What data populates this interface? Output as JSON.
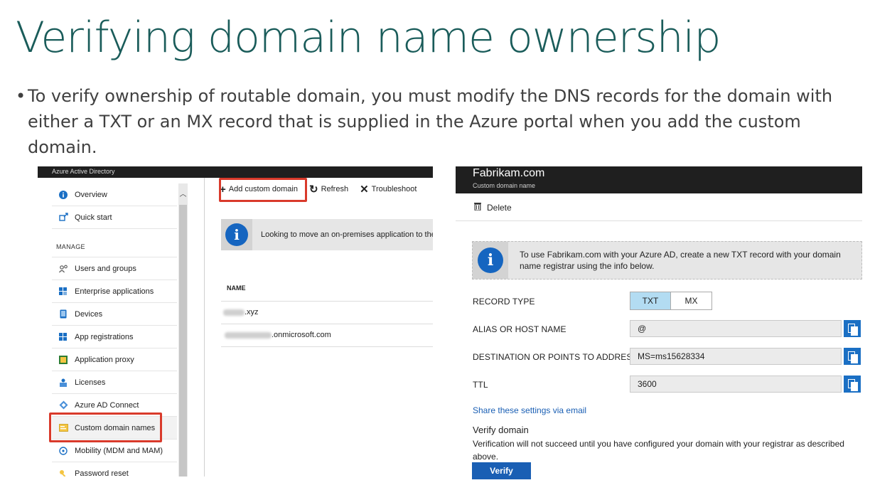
{
  "slide": {
    "title": "Verifying domain name ownership",
    "bullet": "To verify ownership of routable domain, you must modify the DNS records for the domain with either a TXT or an MX record that is supplied in the Azure portal when you add the custom domain."
  },
  "left_panel": {
    "app_title": "Azure Active Directory",
    "nav_top": [
      {
        "label": "Overview",
        "icon": "info-icon"
      },
      {
        "label": "Quick start",
        "icon": "rocket-icon"
      }
    ],
    "manage_heading": "MANAGE",
    "nav_manage": [
      {
        "label": "Users and groups",
        "icon": "users-icon"
      },
      {
        "label": "Enterprise applications",
        "icon": "grid-icon"
      },
      {
        "label": "Devices",
        "icon": "device-icon"
      },
      {
        "label": "App registrations",
        "icon": "grid-icon"
      },
      {
        "label": "Application proxy",
        "icon": "proxy-icon"
      },
      {
        "label": "Licenses",
        "icon": "license-icon"
      },
      {
        "label": "Azure AD Connect",
        "icon": "connect-icon"
      },
      {
        "label": "Custom domain names",
        "icon": "domain-icon"
      },
      {
        "label": "Mobility (MDM and MAM)",
        "icon": "mobility-icon"
      },
      {
        "label": "Password reset",
        "icon": "key-icon"
      }
    ],
    "toolbar": {
      "add": "Add custom domain",
      "refresh": "Refresh",
      "troubleshoot": "Troubleshoot"
    },
    "info_text": "Looking to move an on-premises application to the",
    "table": {
      "column": "NAME",
      "rows": [
        ".xyz",
        ".onmicrosoft.com"
      ]
    }
  },
  "right_panel": {
    "title": "Fabrikam.com",
    "subtitle": "Custom domain name",
    "delete_label": "Delete",
    "info_text": "To use Fabrikam.com with your Azure AD, create a new TXT record with your domain name registrar using the info below.",
    "record_type_label": "RECORD TYPE",
    "record_type_options": [
      "TXT",
      "MX"
    ],
    "record_type_selected": "TXT",
    "alias_label": "ALIAS OR HOST NAME",
    "alias_value": "@",
    "dest_label": "DESTINATION OR POINTS TO ADDRESS",
    "dest_value": "MS=ms15628334",
    "ttl_label": "TTL",
    "ttl_value": "3600",
    "share_link": "Share these settings via email",
    "verify_title": "Verify domain",
    "verify_desc": "Verification will not succeed until you have configured your domain with your registrar as described above.",
    "verify_button": "Verify"
  }
}
